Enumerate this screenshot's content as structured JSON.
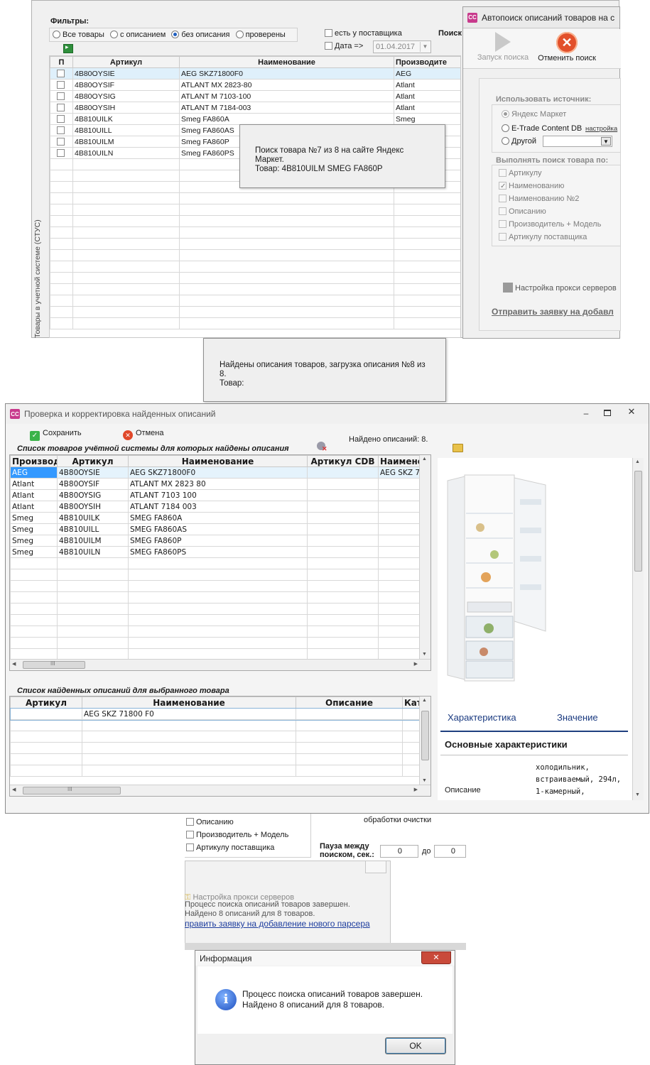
{
  "top_window": {
    "filters_label": "Фильтры:",
    "filter_options": [
      "Все товары",
      "с описанием",
      "без описания",
      "проверены"
    ],
    "selected_filter": "без описания",
    "has_supplier_label": "есть у поставщика",
    "date_label": "Дата =>",
    "date_value": "01.04.2017",
    "search_label": "Поиск",
    "side_label": "Товары в учетной системе (СТУС)",
    "columns": [
      "П",
      "Артикул",
      "Наименование",
      "Производите"
    ],
    "rows": [
      {
        "article": "4B80OYSIE",
        "name": "AEG SKZ71800F0",
        "maker": "AEG"
      },
      {
        "article": "4B80OYSIF",
        "name": "ATLANT MX 2823-80",
        "maker": "Atlant"
      },
      {
        "article": "4B80OYSIG",
        "name": "ATLANT M 7103-100",
        "maker": "Atlant"
      },
      {
        "article": "4B80OYSIH",
        "name": "ATLANT M 7184-003",
        "maker": "Atlant"
      },
      {
        "article": "4B810UILK",
        "name": "Smeg FA860A",
        "maker": "Smeg"
      },
      {
        "article": "4B810UILL",
        "name": "Smeg FA860AS",
        "maker": ""
      },
      {
        "article": "4B810UILM",
        "name": "Smeg FA860P",
        "maker": ""
      },
      {
        "article": "4B810UILN",
        "name": "Smeg FA860PS",
        "maker": ""
      }
    ],
    "progress_msg": {
      "line1": "Поиск товара №7 из 8 на сайте Яндекс Маркет.",
      "line2": "Товар: 4B810UILM SMEG FA860P"
    }
  },
  "autosearch": {
    "title": "Автопоиск описаний товаров на с",
    "start_label": "Запуск поиска",
    "cancel_label": "Отменить поиск",
    "source_label": "Использовать источник:",
    "sources": [
      "Яндекс Маркет",
      "E-Trade Content DB",
      "Другой"
    ],
    "settings_link": "настройка",
    "search_by_label": "Выполнять поиск товара по:",
    "search_by": [
      {
        "label": "Артикулу",
        "checked": false
      },
      {
        "label": "Наименованию",
        "checked": true
      },
      {
        "label": "Наименованию №2",
        "checked": false
      },
      {
        "label": "Описанию",
        "checked": false
      },
      {
        "label": "Производитель + Модель",
        "checked": false
      },
      {
        "label": "Артикулу поставщика",
        "checked": false
      }
    ],
    "proxy_label": "Настройка прокси серверов",
    "request_link": "Отправить заявку на добавл"
  },
  "load_msg": {
    "line1": "Найдены описания товаров, загрузка описания №8 из 8.",
    "line2": "Товар:"
  },
  "review_window": {
    "title": "Проверка и корректировка найденных описаний",
    "save_label": "Сохранить",
    "cancel_label": "Отмена",
    "found_label": "Найдено описаний: 8.",
    "list1_title": "Список товаров учётной системы для которых найдены описания",
    "list1_columns": [
      "Производи",
      "Артикул",
      "Наименование",
      "Артикул CDB",
      "Наимено"
    ],
    "list1_rows": [
      {
        "maker": "AEG",
        "article": "4B80OYSIE",
        "name": "AEG SKZ71800F0",
        "cdb": "",
        "name2": "AEG SKZ 7:"
      },
      {
        "maker": "Atlant",
        "article": "4B80OYSIF",
        "name": "ATLANT MX 2823 80",
        "cdb": "",
        "name2": ""
      },
      {
        "maker": "Atlant",
        "article": "4B80OYSIG",
        "name": "ATLANT 7103 100",
        "cdb": "",
        "name2": ""
      },
      {
        "maker": "Atlant",
        "article": "4B80OYSIH",
        "name": "ATLANT 7184 003",
        "cdb": "",
        "name2": ""
      },
      {
        "maker": "Smeg",
        "article": "4B810UILK",
        "name": "SMEG FA860A",
        "cdb": "",
        "name2": ""
      },
      {
        "maker": "Smeg",
        "article": "4B810UILL",
        "name": "SMEG FA860AS",
        "cdb": "",
        "name2": ""
      },
      {
        "maker": "Smeg",
        "article": "4B810UILM",
        "name": "SMEG FA860P",
        "cdb": "",
        "name2": ""
      },
      {
        "maker": "Smeg",
        "article": "4B810UILN",
        "name": "SMEG FA860PS",
        "cdb": "",
        "name2": ""
      }
    ],
    "list2_title": "Список найденных описаний для выбранного товара",
    "list2_columns": [
      "Артикул",
      "Наименование",
      "Описание",
      "Кат"
    ],
    "list2_rows": [
      {
        "article": "",
        "name": "AEG SKZ 71800 F0",
        "desc": "",
        "cat": ""
      }
    ],
    "char_header": "Характеристика",
    "value_header": "Значение",
    "section_title": "Основные характеристики",
    "desc_key": "Описание",
    "desc_value_lines": [
      "холодильник,",
      "встраиваемый, 294л,",
      "1-камерный,"
    ]
  },
  "bottom_bg": {
    "items": [
      "Описанию",
      "Производитель + Модель",
      "Артикулу поставщика"
    ],
    "cleanup_label": "обработки очистки",
    "pause_label1": "Пауза между",
    "pause_label2": "поиском, сек.:",
    "pause_from": "0",
    "pause_to_label": "до",
    "pause_to": "0",
    "proxy_label": "Настройка прокси серверов",
    "msg_line1": "Процесс поиска описаний товаров завершен.",
    "msg_line2": "Найдено 8 описаний для 8 товаров.",
    "request_link": "править заявку на добавление нового парсера"
  },
  "info_dialog": {
    "title": "Информация",
    "line1": "Процесс поиска описаний товаров завершен.",
    "line2": "Найдено 8 описаний для 8 товаров.",
    "ok_label": "OK"
  }
}
